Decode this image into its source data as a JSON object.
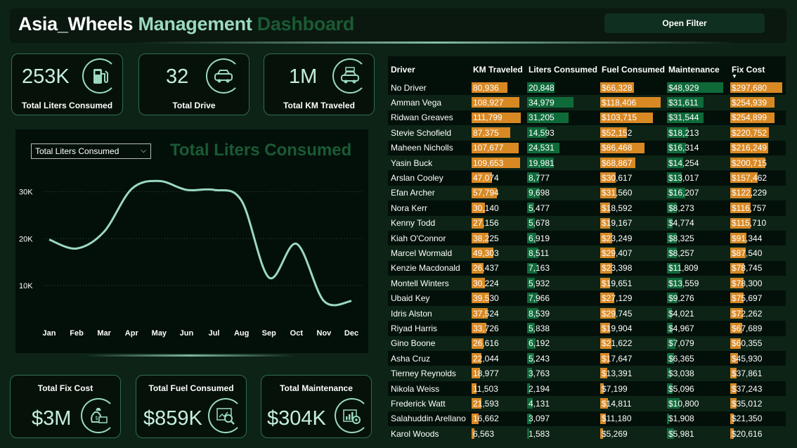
{
  "header": {
    "title_part1": "Asia_Wheels",
    "title_part2": "Management",
    "title_part3": "Dashboard",
    "filter_button": "Open Filter"
  },
  "kpis_top": [
    {
      "value": "253K",
      "label": "Total Liters Consumed",
      "icon": "fuel-pump-icon"
    },
    {
      "value": "32",
      "label": "Total Drive",
      "icon": "cars-icon"
    },
    {
      "value": "1M",
      "label": "Total KM Traveled",
      "icon": "car-luggage-icon"
    }
  ],
  "kpis_bottom": [
    {
      "value": "$3M",
      "label": "Total Fix Cost",
      "icon": "money-bag-icon"
    },
    {
      "value": "$859K",
      "label": "Total Fuel Consumed",
      "icon": "report-magnifier-icon"
    },
    {
      "value": "$304K",
      "label": "Total Maintenance",
      "icon": "chart-gear-icon"
    }
  ],
  "chart": {
    "selector_value": "Total Liters Consumed",
    "title": "Total Liters Consumed"
  },
  "chart_data": {
    "type": "line",
    "title": "Total Liters Consumed",
    "categories": [
      "Jan",
      "Feb",
      "Mar",
      "Apr",
      "May",
      "Jun",
      "Jul",
      "Aug",
      "Sep",
      "Oct",
      "Nov",
      "Dec"
    ],
    "values": [
      19800,
      17900,
      21500,
      30600,
      32300,
      30400,
      30400,
      28100,
      11700,
      18900,
      6700,
      6700
    ],
    "yticks": [
      10000,
      20000,
      30000
    ],
    "ytick_labels": [
      "10K",
      "20K",
      "30K"
    ],
    "ylim": [
      4000,
      34000
    ],
    "grid": true,
    "line_color": "#9bd9c0"
  },
  "table": {
    "columns": [
      "Driver",
      "KM Traveled",
      "Liters Consumed",
      "Fuel Consumed",
      "Maintenance",
      "Fix Cost"
    ],
    "sorted_column": "Fix Cost",
    "max": {
      "km": 111799,
      "liters": 34979,
      "fuel": 118406,
      "maint": 48929,
      "fix": 297680
    },
    "rows": [
      {
        "driver": "No Driver",
        "km": "80,936",
        "liters": "20,848",
        "fuel": "$66,328",
        "maint": "$48,929",
        "fix": "$297,680"
      },
      {
        "driver": "Amman Vega",
        "km": "108,927",
        "liters": "34,979",
        "fuel": "$118,406",
        "maint": "$31,611",
        "fix": "$254,939"
      },
      {
        "driver": "Ridwan Greaves",
        "km": "111,799",
        "liters": "31,205",
        "fuel": "$103,715",
        "maint": "$31,544",
        "fix": "$254,899"
      },
      {
        "driver": "Stevie Schofield",
        "km": "87,375",
        "liters": "14,593",
        "fuel": "$52,152",
        "maint": "$18,213",
        "fix": "$220,752"
      },
      {
        "driver": "Maheen Nicholls",
        "km": "107,677",
        "liters": "24,531",
        "fuel": "$86,468",
        "maint": "$16,314",
        "fix": "$216,249"
      },
      {
        "driver": "Yasin Buck",
        "km": "109,653",
        "liters": "19,981",
        "fuel": "$68,867",
        "maint": "$14,254",
        "fix": "$200,715"
      },
      {
        "driver": "Arslan Cooley",
        "km": "47,074",
        "liters": "8,777",
        "fuel": "$30,617",
        "maint": "$13,017",
        "fix": "$157,462"
      },
      {
        "driver": "Efan Archer",
        "km": "57,794",
        "liters": "9,698",
        "fuel": "$31,560",
        "maint": "$16,207",
        "fix": "$122,229"
      },
      {
        "driver": "Nora Kerr",
        "km": "30,140",
        "liters": "5,477",
        "fuel": "$18,592",
        "maint": "$8,273",
        "fix": "$116,757"
      },
      {
        "driver": "Kenny Todd",
        "km": "27,156",
        "liters": "5,678",
        "fuel": "$19,167",
        "maint": "$4,774",
        "fix": "$115,710"
      },
      {
        "driver": "Kiah O'Connor",
        "km": "38,225",
        "liters": "6,919",
        "fuel": "$23,249",
        "maint": "$8,325",
        "fix": "$91,344"
      },
      {
        "driver": "Marcel Wormald",
        "km": "49,303",
        "liters": "8,511",
        "fuel": "$29,407",
        "maint": "$8,257",
        "fix": "$87,540"
      },
      {
        "driver": "Kenzie Macdonald",
        "km": "26,437",
        "liters": "7,163",
        "fuel": "$23,398",
        "maint": "$11,809",
        "fix": "$78,745"
      },
      {
        "driver": "Montell Winters",
        "km": "30,224",
        "liters": "5,932",
        "fuel": "$19,651",
        "maint": "$13,559",
        "fix": "$78,300"
      },
      {
        "driver": "Ubaid Key",
        "km": "39,530",
        "liters": "7,966",
        "fuel": "$27,129",
        "maint": "$9,276",
        "fix": "$75,697"
      },
      {
        "driver": "Idris Alston",
        "km": "37,524",
        "liters": "8,539",
        "fuel": "$29,745",
        "maint": "$4,021",
        "fix": "$72,262"
      },
      {
        "driver": "Riyad Harris",
        "km": "33,726",
        "liters": "5,838",
        "fuel": "$19,904",
        "maint": "$4,967",
        "fix": "$67,689"
      },
      {
        "driver": "Gino Boone",
        "km": "26,616",
        "liters": "6,192",
        "fuel": "$21,622",
        "maint": "$7,079",
        "fix": "$60,355"
      },
      {
        "driver": "Asha Cruz",
        "km": "22,044",
        "liters": "5,243",
        "fuel": "$17,647",
        "maint": "$6,365",
        "fix": "$45,930"
      },
      {
        "driver": "Tierney Reynolds",
        "km": "18,977",
        "liters": "3,763",
        "fuel": "$13,391",
        "maint": "$3,038",
        "fix": "$37,861"
      },
      {
        "driver": "Nikola Weiss",
        "km": "11,503",
        "liters": "2,194",
        "fuel": "$7,199",
        "maint": "$5,096",
        "fix": "$37,243"
      },
      {
        "driver": "Frederick Watt",
        "km": "21,593",
        "liters": "4,131",
        "fuel": "$14,811",
        "maint": "$10,800",
        "fix": "$35,012"
      },
      {
        "driver": "Salahuddin Arellano",
        "km": "16,662",
        "liters": "3,097",
        "fuel": "$11,180",
        "maint": "$1,908",
        "fix": "$21,350"
      },
      {
        "driver": "Karol Woods",
        "km": "6,563",
        "liters": "1,583",
        "fuel": "$5,269",
        "maint": "$5,981",
        "fix": "$20,616"
      }
    ]
  },
  "colors": {
    "accent": "#9bd9c0",
    "bar_orange": "#d98924",
    "bar_green": "#0f6a3a",
    "title_dark_green": "#1a5a34"
  }
}
